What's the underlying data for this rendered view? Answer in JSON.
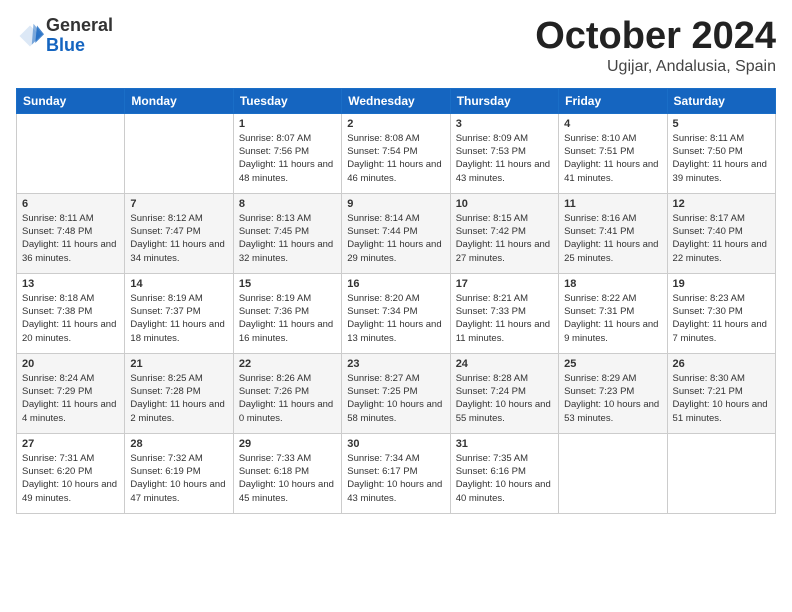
{
  "header": {
    "logo_general": "General",
    "logo_blue": "Blue",
    "month_title": "October 2024",
    "location": "Ugijar, Andalusia, Spain"
  },
  "days_of_week": [
    "Sunday",
    "Monday",
    "Tuesday",
    "Wednesday",
    "Thursday",
    "Friday",
    "Saturday"
  ],
  "weeks": [
    [
      {
        "date": "",
        "content": ""
      },
      {
        "date": "",
        "content": ""
      },
      {
        "date": "1",
        "content": "Sunrise: 8:07 AM\nSunset: 7:56 PM\nDaylight: 11 hours and 48 minutes."
      },
      {
        "date": "2",
        "content": "Sunrise: 8:08 AM\nSunset: 7:54 PM\nDaylight: 11 hours and 46 minutes."
      },
      {
        "date": "3",
        "content": "Sunrise: 8:09 AM\nSunset: 7:53 PM\nDaylight: 11 hours and 43 minutes."
      },
      {
        "date": "4",
        "content": "Sunrise: 8:10 AM\nSunset: 7:51 PM\nDaylight: 11 hours and 41 minutes."
      },
      {
        "date": "5",
        "content": "Sunrise: 8:11 AM\nSunset: 7:50 PM\nDaylight: 11 hours and 39 minutes."
      }
    ],
    [
      {
        "date": "6",
        "content": "Sunrise: 8:11 AM\nSunset: 7:48 PM\nDaylight: 11 hours and 36 minutes."
      },
      {
        "date": "7",
        "content": "Sunrise: 8:12 AM\nSunset: 7:47 PM\nDaylight: 11 hours and 34 minutes."
      },
      {
        "date": "8",
        "content": "Sunrise: 8:13 AM\nSunset: 7:45 PM\nDaylight: 11 hours and 32 minutes."
      },
      {
        "date": "9",
        "content": "Sunrise: 8:14 AM\nSunset: 7:44 PM\nDaylight: 11 hours and 29 minutes."
      },
      {
        "date": "10",
        "content": "Sunrise: 8:15 AM\nSunset: 7:42 PM\nDaylight: 11 hours and 27 minutes."
      },
      {
        "date": "11",
        "content": "Sunrise: 8:16 AM\nSunset: 7:41 PM\nDaylight: 11 hours and 25 minutes."
      },
      {
        "date": "12",
        "content": "Sunrise: 8:17 AM\nSunset: 7:40 PM\nDaylight: 11 hours and 22 minutes."
      }
    ],
    [
      {
        "date": "13",
        "content": "Sunrise: 8:18 AM\nSunset: 7:38 PM\nDaylight: 11 hours and 20 minutes."
      },
      {
        "date": "14",
        "content": "Sunrise: 8:19 AM\nSunset: 7:37 PM\nDaylight: 11 hours and 18 minutes."
      },
      {
        "date": "15",
        "content": "Sunrise: 8:19 AM\nSunset: 7:36 PM\nDaylight: 11 hours and 16 minutes."
      },
      {
        "date": "16",
        "content": "Sunrise: 8:20 AM\nSunset: 7:34 PM\nDaylight: 11 hours and 13 minutes."
      },
      {
        "date": "17",
        "content": "Sunrise: 8:21 AM\nSunset: 7:33 PM\nDaylight: 11 hours and 11 minutes."
      },
      {
        "date": "18",
        "content": "Sunrise: 8:22 AM\nSunset: 7:31 PM\nDaylight: 11 hours and 9 minutes."
      },
      {
        "date": "19",
        "content": "Sunrise: 8:23 AM\nSunset: 7:30 PM\nDaylight: 11 hours and 7 minutes."
      }
    ],
    [
      {
        "date": "20",
        "content": "Sunrise: 8:24 AM\nSunset: 7:29 PM\nDaylight: 11 hours and 4 minutes."
      },
      {
        "date": "21",
        "content": "Sunrise: 8:25 AM\nSunset: 7:28 PM\nDaylight: 11 hours and 2 minutes."
      },
      {
        "date": "22",
        "content": "Sunrise: 8:26 AM\nSunset: 7:26 PM\nDaylight: 11 hours and 0 minutes."
      },
      {
        "date": "23",
        "content": "Sunrise: 8:27 AM\nSunset: 7:25 PM\nDaylight: 10 hours and 58 minutes."
      },
      {
        "date": "24",
        "content": "Sunrise: 8:28 AM\nSunset: 7:24 PM\nDaylight: 10 hours and 55 minutes."
      },
      {
        "date": "25",
        "content": "Sunrise: 8:29 AM\nSunset: 7:23 PM\nDaylight: 10 hours and 53 minutes."
      },
      {
        "date": "26",
        "content": "Sunrise: 8:30 AM\nSunset: 7:21 PM\nDaylight: 10 hours and 51 minutes."
      }
    ],
    [
      {
        "date": "27",
        "content": "Sunrise: 7:31 AM\nSunset: 6:20 PM\nDaylight: 10 hours and 49 minutes."
      },
      {
        "date": "28",
        "content": "Sunrise: 7:32 AM\nSunset: 6:19 PM\nDaylight: 10 hours and 47 minutes."
      },
      {
        "date": "29",
        "content": "Sunrise: 7:33 AM\nSunset: 6:18 PM\nDaylight: 10 hours and 45 minutes."
      },
      {
        "date": "30",
        "content": "Sunrise: 7:34 AM\nSunset: 6:17 PM\nDaylight: 10 hours and 43 minutes."
      },
      {
        "date": "31",
        "content": "Sunrise: 7:35 AM\nSunset: 6:16 PM\nDaylight: 10 hours and 40 minutes."
      },
      {
        "date": "",
        "content": ""
      },
      {
        "date": "",
        "content": ""
      }
    ]
  ]
}
